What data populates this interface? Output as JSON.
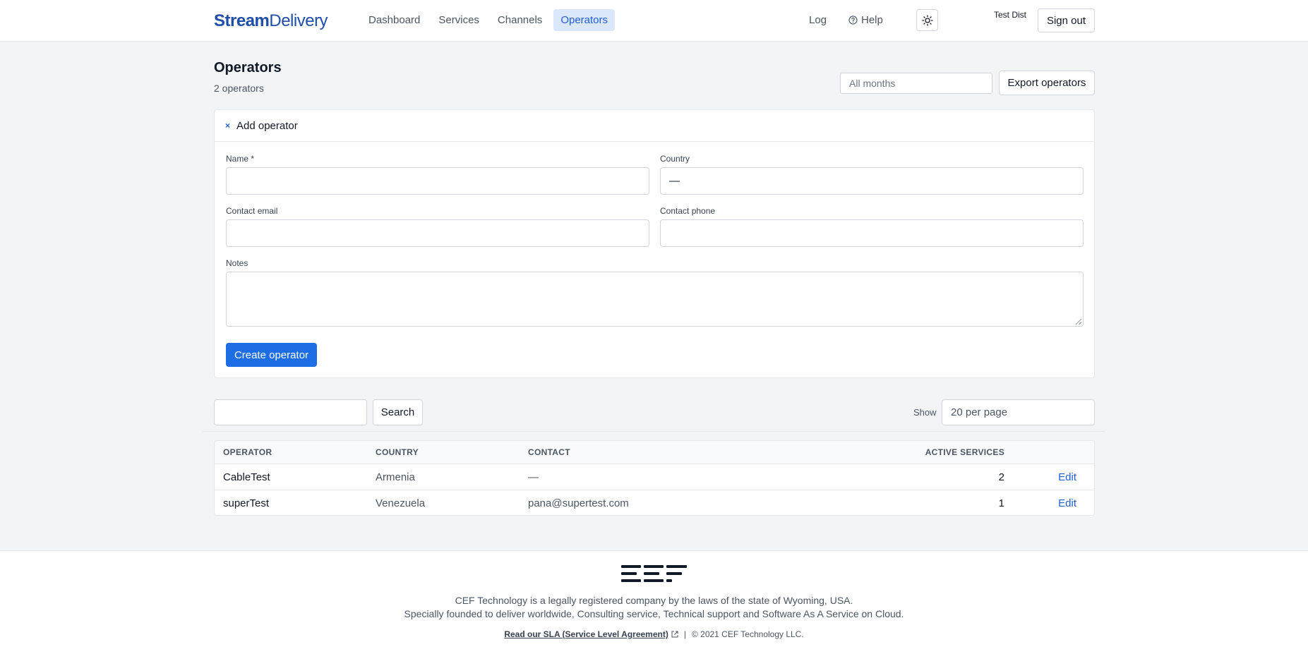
{
  "header": {
    "brand_part1": "Stream",
    "brand_part2": "Delivery",
    "nav": [
      {
        "label": "Dashboard"
      },
      {
        "label": "Services"
      },
      {
        "label": "Channels"
      },
      {
        "label": "Operators"
      }
    ],
    "active_nav": "Operators",
    "log": "Log",
    "help": "Help",
    "user_name": "Test Dist",
    "sign_out": "Sign out"
  },
  "page": {
    "title": "Operators",
    "count": "2 operators",
    "month_filter": "All months",
    "export_label": "Export operators"
  },
  "form": {
    "toggle_icon": "×",
    "title": "Add operator",
    "name_label": "Name *",
    "name_value": "",
    "country_label": "Country",
    "country_value": "—",
    "email_label": "Contact email",
    "email_value": "",
    "phone_label": "Contact phone",
    "phone_value": "",
    "notes_label": "Notes",
    "notes_value": "",
    "submit_label": "Create operator"
  },
  "search": {
    "value": "",
    "button_label": "Search",
    "show_label": "Show",
    "per_page": "20 per page"
  },
  "table": {
    "headers": {
      "operator": "OPERATOR",
      "country": "COUNTRY",
      "contact": "CONTACT",
      "active_services": "ACTIVE SERVICES"
    },
    "rows": [
      {
        "operator": "CableTest",
        "country": "Armenia",
        "contact": "—",
        "active_services": "2",
        "action": "Edit"
      },
      {
        "operator": "superTest",
        "country": "Venezuela",
        "contact": "pana@supertest.com",
        "active_services": "1",
        "action": "Edit"
      }
    ]
  },
  "footer": {
    "line1": "CEF Technology is a legally registered company by the laws of the state of Wyoming, USA.",
    "line2": "Specially founded to deliver worldwide, Consulting service, Technical support and Software As A Service on Cloud.",
    "sla_link": "Read our SLA (Service Level Agreement)",
    "separator": "|",
    "copyright": "© 2021 CEF Technology LLC."
  },
  "colors": {
    "accent": "#1d6ee5",
    "link": "#1d5fd6",
    "brand": "#1e4fa8",
    "page_bg": "#f3f4f6"
  },
  "icons": {
    "help": "question-circle-icon",
    "theme": "sun-icon",
    "external": "external-link-icon",
    "logo": "cef-logo"
  }
}
